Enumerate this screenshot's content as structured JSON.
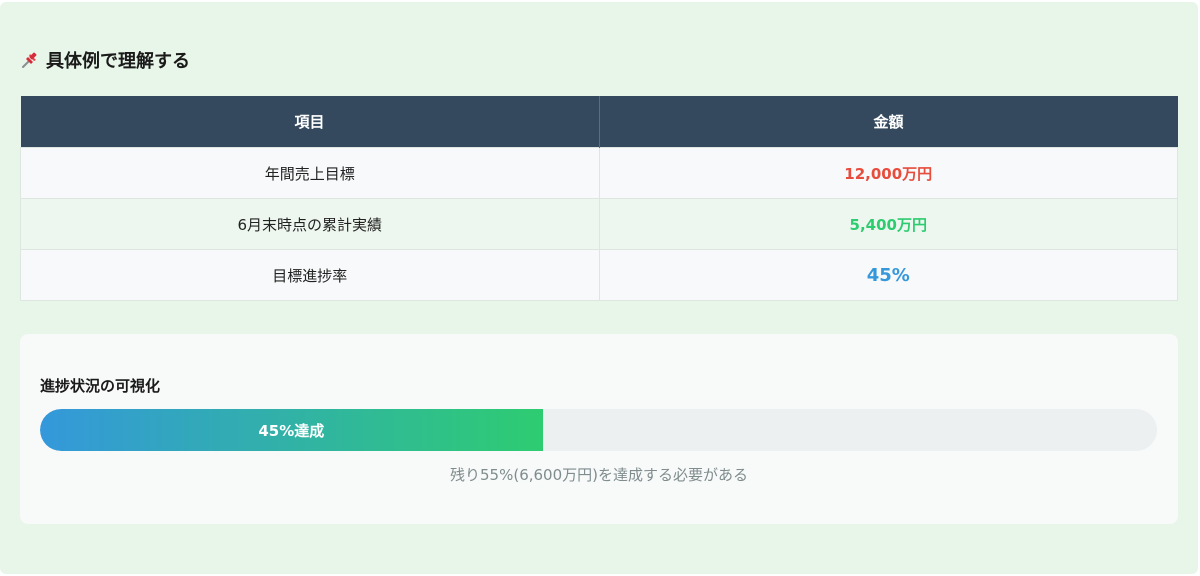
{
  "heading": {
    "icon": "pushpin-icon",
    "title": "具体例で理解する"
  },
  "table": {
    "headers": [
      "項目",
      "金額"
    ],
    "rows": [
      {
        "item": "年間売上目標",
        "amount": "12,000万円",
        "color": "#e74c3c"
      },
      {
        "item": "6月末時点の累計実績",
        "amount": "5,400万円",
        "color": "#2ecc71"
      },
      {
        "item": "目標進捗率",
        "amount": "45%",
        "color": "#3498db"
      }
    ]
  },
  "progress": {
    "title": "進捗状況の可視化",
    "percent": 45,
    "label": "45%達成",
    "remaining_text": "残り55%(6,600万円)を達成する必要がある"
  },
  "colors": {
    "header_bg": "#34495e",
    "background": "#e8f5e9",
    "gradient_start": "#3498db",
    "gradient_end": "#2ecc71"
  }
}
